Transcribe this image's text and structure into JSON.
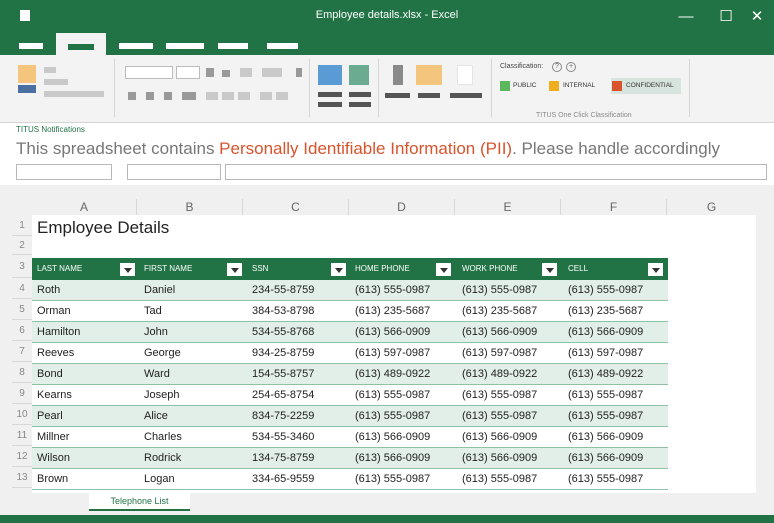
{
  "window": {
    "title": "Employee details.xlsx - Excel",
    "controls": {
      "minimize": "—",
      "maximize": "☐",
      "close": "✕"
    }
  },
  "ribbon": {
    "classification": {
      "title": "Classification:",
      "info_glyph": "?",
      "add_glyph": "+",
      "options": [
        {
          "label": "PUBLIC",
          "color": "#5cb85c"
        },
        {
          "label": "INTERNAL",
          "color": "#f0ad1e"
        },
        {
          "label": "CONFIDENTIAL",
          "color": "#d9532b"
        }
      ],
      "group_label": "TITUS One Click Classification"
    }
  },
  "notification": {
    "label": "TITUS Notifications",
    "text_before": "This spreadsheet contains ",
    "text_highlight": "Personally Identifiable Information (PII)",
    "text_after": ". Please handle accordingly"
  },
  "sheet": {
    "columns": [
      "A",
      "B",
      "C",
      "D",
      "E",
      "F",
      "G"
    ],
    "rows": [
      "1",
      "2",
      "3",
      "4",
      "5",
      "6",
      "7",
      "8",
      "9",
      "10",
      "11",
      "12",
      "13"
    ],
    "title": "Employee Details",
    "headers": [
      "LAST NAME",
      "FIRST NAME",
      "SSN",
      "HOME PHONE",
      "WORK PHONE",
      "CELL"
    ],
    "data": [
      [
        "Roth",
        "Daniel",
        "234-55-8759",
        "(613) 555-0987",
        "(613) 555-0987",
        "(613) 555-0987"
      ],
      [
        "Orman",
        "Tad",
        "384-53-8798",
        "(613) 235-5687",
        "(613) 235-5687",
        "(613) 235-5687"
      ],
      [
        "Hamilton",
        "John",
        "534-55-8768",
        "(613) 566-0909",
        "(613) 566-0909",
        "(613) 566-0909"
      ],
      [
        "Reeves",
        "George",
        "934-25-8759",
        "(613) 597-0987",
        "(613) 597-0987",
        "(613) 597-0987"
      ],
      [
        "Bond",
        "Ward",
        "154-55-8757",
        "(613) 489-0922",
        "(613) 489-0922",
        "(613) 489-0922"
      ],
      [
        "Kearns",
        "Joseph",
        "254-65-8754",
        "(613) 555-0987",
        "(613) 555-0987",
        "(613) 555-0987"
      ],
      [
        "Pearl",
        "Alice",
        "834-75-2259",
        "(613) 555-0987",
        "(613) 555-0987",
        "(613) 555-0987"
      ],
      [
        "Millner",
        "Charles",
        "534-55-3460",
        "(613) 566-0909",
        "(613) 566-0909",
        "(613) 566-0909"
      ],
      [
        "Wilson",
        "Rodrick",
        "134-75-8759",
        "(613) 566-0909",
        "(613) 566-0909",
        "(613) 566-0909"
      ],
      [
        "Brown",
        "Logan",
        "334-65-9559",
        "(613) 555-0987",
        "(613) 555-0987",
        "(613) 555-0987"
      ]
    ],
    "tab_label": "Telephone List"
  },
  "colors": {
    "accent": "#217346",
    "pii": "#d9532b"
  }
}
